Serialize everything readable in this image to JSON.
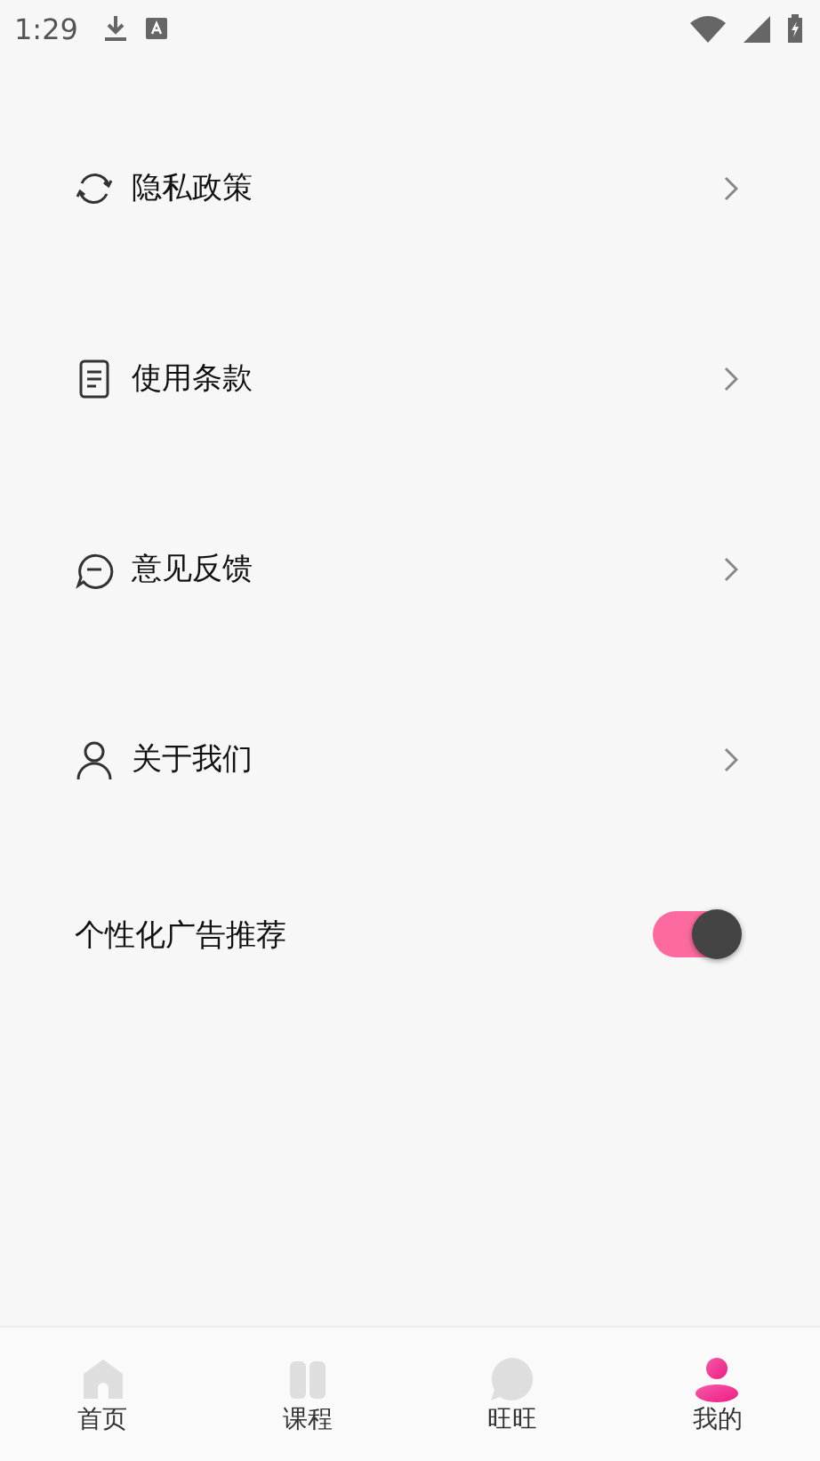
{
  "status_bar": {
    "time": "1:29"
  },
  "menu": [
    {
      "kind": "refresh",
      "label": "隐私政策"
    },
    {
      "kind": "document",
      "label": "使用条款"
    },
    {
      "kind": "chat",
      "label": "意见反馈"
    },
    {
      "kind": "person",
      "label": "关于我们"
    }
  ],
  "ad_setting": {
    "label": "个性化广告推荐",
    "on": true
  },
  "tab_bar": [
    {
      "kind": "home",
      "label": "首页",
      "selected": false
    },
    {
      "kind": "book",
      "label": "课程",
      "selected": false
    },
    {
      "kind": "chat",
      "label": "旺旺",
      "selected": false
    },
    {
      "kind": "person",
      "label": "我的",
      "selected": true
    }
  ]
}
